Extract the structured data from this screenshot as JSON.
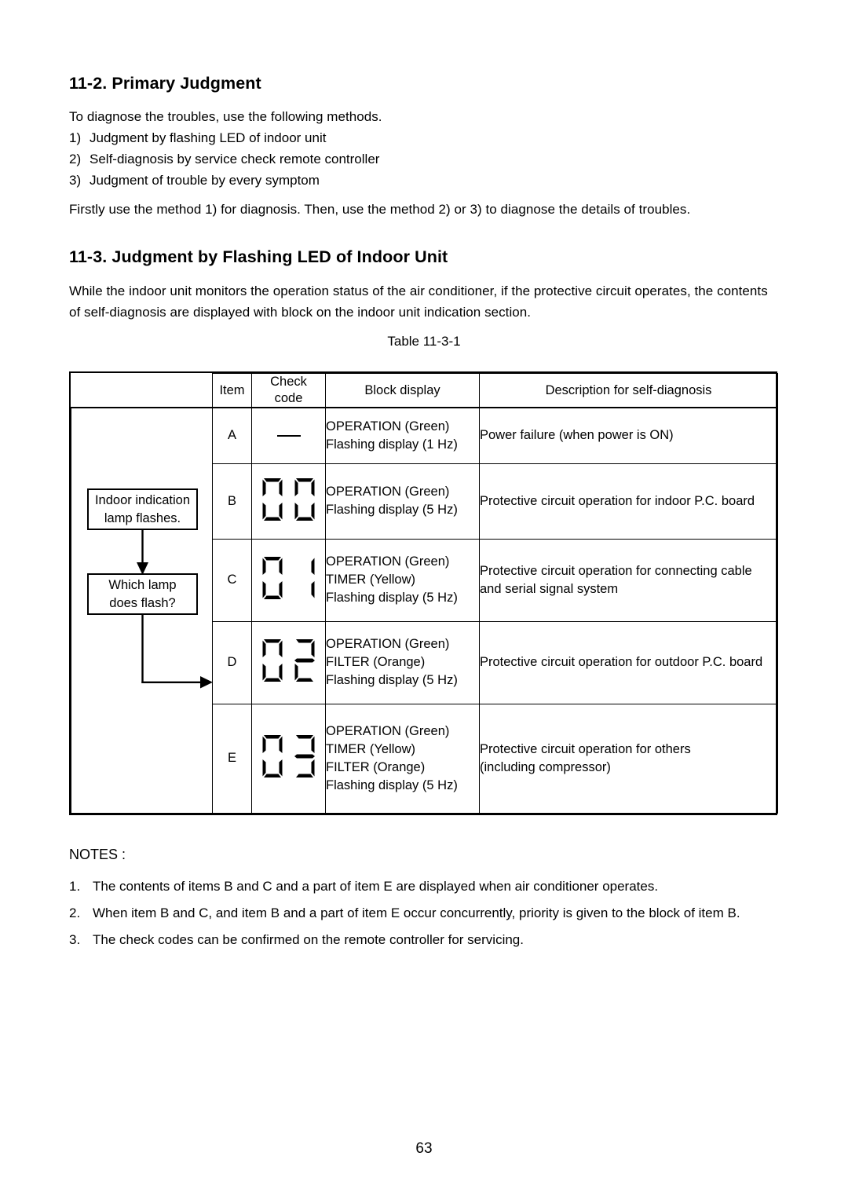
{
  "sections": {
    "s112": {
      "heading": "11-2.  Primary Judgment",
      "intro": "To diagnose the troubles, use the following methods.",
      "methods": [
        {
          "num": "1)",
          "text": "Judgment by flashing LED of indoor unit"
        },
        {
          "num": "2)",
          "text": "Self-diagnosis by service check remote controller"
        },
        {
          "num": "3)",
          "text": "Judgment of trouble by every symptom"
        }
      ],
      "firstly": "Firstly use the method 1) for diagnosis. Then, use the method 2) or 3) to diagnose the details of troubles."
    },
    "s113": {
      "heading": "11-3.  Judgment by Flashing LED of Indoor Unit",
      "lead": "While the indoor unit monitors the operation status of the air conditioner, if the protective circuit operates, the contents of self-diagnosis are displayed with block on the indoor unit indication section.",
      "table_caption": "Table 11-3-1"
    }
  },
  "flowchart": {
    "box1": "Indoor indication\nlamp flashes.",
    "box1_line1": "Indoor indication",
    "box1_line2": "lamp flashes.",
    "box2_line1": "Which lamp",
    "box2_line2": "does flash?"
  },
  "table": {
    "headers": {
      "flow": "",
      "item": "Item",
      "code_line1": "Check",
      "code_line2": "code",
      "block": "Block display",
      "desc": "Description for self-diagnosis"
    },
    "rows": [
      {
        "item": "A",
        "code": "—",
        "code_type": "dash",
        "block_lines": [
          "OPERATION (Green)",
          "Flashing display (1 Hz)"
        ],
        "desc_lines": [
          "Power failure (when power is ON)"
        ]
      },
      {
        "item": "B",
        "code": "00",
        "code_type": "seven-segment",
        "block_lines": [
          "OPERATION (Green)",
          "Flashing display (5 Hz)"
        ],
        "desc_lines": [
          "Protective circuit operation for indoor P.C. board"
        ]
      },
      {
        "item": "C",
        "code": "01",
        "code_type": "seven-segment",
        "block_lines": [
          "OPERATION (Green)",
          "TIMER (Yellow)",
          "Flashing display (5 Hz)"
        ],
        "desc_lines": [
          "Protective circuit operation for connecting cable",
          "and serial signal system"
        ]
      },
      {
        "item": "D",
        "code": "02",
        "code_type": "seven-segment",
        "block_lines": [
          "OPERATION (Green)",
          "FILTER (Orange)",
          "Flashing display (5 Hz)"
        ],
        "desc_lines": [
          "Protective circuit operation for outdoor P.C. board"
        ]
      },
      {
        "item": "E",
        "code": "03",
        "code_type": "seven-segment",
        "block_lines": [
          "OPERATION (Green)",
          "TIMER (Yellow)",
          "FILTER (Orange)",
          "Flashing display (5 Hz)"
        ],
        "desc_lines": [
          "Protective circuit operation for others",
          "(including compressor)"
        ]
      }
    ]
  },
  "notes": {
    "title": "NOTES :",
    "items": [
      {
        "num": "1.",
        "text": "The contents of items B and C and a part of item E are displayed when air conditioner operates."
      },
      {
        "num": "2.",
        "text": "When item B and C, and item B and a part of item E occur concurrently, priority is given to the block of item B."
      },
      {
        "num": "3.",
        "text": "The check codes can be confirmed on the remote controller for servicing."
      }
    ]
  },
  "page_number": "63"
}
